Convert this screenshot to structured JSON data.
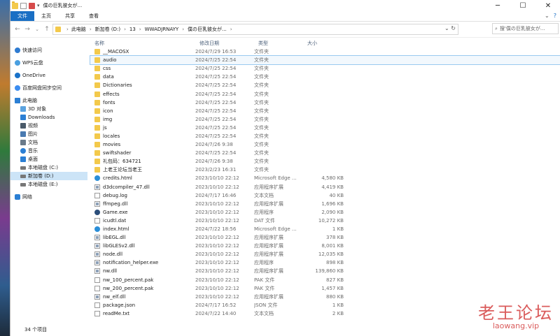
{
  "window": {
    "title": "僕の巨乳彼女が...",
    "controls": {
      "minimize": "─",
      "maximize": "☐",
      "close": "✕"
    }
  },
  "ribbon": {
    "tabs": [
      "文件",
      "主页",
      "共享",
      "查看"
    ],
    "active_tab": "文件"
  },
  "address": {
    "crumbs": [
      "此电脑",
      "新加卷 (D:)",
      "13",
      "WWADJRNAYY",
      "僕の巨乳彼女が..."
    ],
    "search_placeholder": "搜'僕の巨乳彼女が..."
  },
  "nav": {
    "items": [
      {
        "label": "快速访问",
        "icon": "star-icon",
        "color": "#2e7bd1",
        "indent": 1
      },
      {
        "label": "WPS云盘",
        "icon": "cloud-icon",
        "color": "#4a9fe0",
        "indent": 1
      },
      {
        "label": "OneDrive",
        "icon": "cloud-icon",
        "color": "#1a72c9",
        "indent": 1
      },
      {
        "label": "百度网盘同步空间",
        "icon": "cloud-icon",
        "color": "#3b8df0",
        "indent": 1
      },
      {
        "label": "此电脑",
        "icon": "computer-icon",
        "color": "#2b7fd4",
        "indent": 1
      },
      {
        "label": "3D 对象",
        "icon": "cube-icon",
        "color": "#5ba3e0",
        "indent": 2
      },
      {
        "label": "Downloads",
        "icon": "download-icon",
        "color": "#2b7fd4",
        "indent": 2
      },
      {
        "label": "视频",
        "icon": "video-icon",
        "color": "#4a5a6a",
        "indent": 2
      },
      {
        "label": "图片",
        "icon": "picture-icon",
        "color": "#4a7ab0",
        "indent": 2
      },
      {
        "label": "文档",
        "icon": "document-icon",
        "color": "#6a7a8a",
        "indent": 2
      },
      {
        "label": "音乐",
        "icon": "music-icon",
        "color": "#2b7fd4",
        "indent": 2
      },
      {
        "label": "桌面",
        "icon": "desktop-icon",
        "color": "#2b7fd4",
        "indent": 2
      },
      {
        "label": "本地磁盘 (C:)",
        "icon": "drive-icon",
        "color": "#777777",
        "indent": 2
      },
      {
        "label": "新加卷 (D:)",
        "icon": "drive-icon",
        "color": "#777777",
        "indent": 2,
        "selected": true
      },
      {
        "label": "本地磁盘 (E:)",
        "icon": "drive-icon",
        "color": "#777777",
        "indent": 2
      },
      {
        "label": "网络",
        "icon": "network-icon",
        "color": "#2b7fd4",
        "indent": 1
      }
    ]
  },
  "list": {
    "headers": {
      "name": "名称",
      "date": "修改日期",
      "type": "类型",
      "size": "大小"
    },
    "rows": [
      {
        "name": "__MACOSX",
        "date": "2024/7/29 16:53",
        "type": "文件夹",
        "size": "",
        "kind": "folder"
      },
      {
        "name": "audio",
        "date": "2024/7/25 22:54",
        "type": "文件夹",
        "size": "",
        "kind": "folder",
        "highlight": true
      },
      {
        "name": "css",
        "date": "2024/7/25 22:54",
        "type": "文件夹",
        "size": "",
        "kind": "folder"
      },
      {
        "name": "data",
        "date": "2024/7/25 22:54",
        "type": "文件夹",
        "size": "",
        "kind": "folder"
      },
      {
        "name": "Dictionaries",
        "date": "2024/7/25 22:54",
        "type": "文件夹",
        "size": "",
        "kind": "folder"
      },
      {
        "name": "effects",
        "date": "2024/7/25 22:54",
        "type": "文件夹",
        "size": "",
        "kind": "folder"
      },
      {
        "name": "fonts",
        "date": "2024/7/25 22:54",
        "type": "文件夹",
        "size": "",
        "kind": "folder"
      },
      {
        "name": "icon",
        "date": "2024/7/25 22:54",
        "type": "文件夹",
        "size": "",
        "kind": "folder"
      },
      {
        "name": "img",
        "date": "2024/7/25 22:54",
        "type": "文件夹",
        "size": "",
        "kind": "folder"
      },
      {
        "name": "js",
        "date": "2024/7/25 22:54",
        "type": "文件夹",
        "size": "",
        "kind": "folder"
      },
      {
        "name": "locales",
        "date": "2024/7/25 22:54",
        "type": "文件夹",
        "size": "",
        "kind": "folder"
      },
      {
        "name": "movies",
        "date": "2024/7/26 9:38",
        "type": "文件夹",
        "size": "",
        "kind": "folder"
      },
      {
        "name": "swiftshader",
        "date": "2024/7/25 22:54",
        "type": "文件夹",
        "size": "",
        "kind": "folder"
      },
      {
        "name": "礼包码：634721",
        "date": "2024/7/26 9:38",
        "type": "文件夹",
        "size": "",
        "kind": "folder"
      },
      {
        "name": "上老王论坛当老王",
        "date": "2023/2/23 16:31",
        "type": "文件夹",
        "size": "",
        "kind": "folder"
      },
      {
        "name": "credits.html",
        "date": "2023/10/10 22:12",
        "type": "Microsoft Edge ...",
        "size": "4,580 KB",
        "kind": "edge"
      },
      {
        "name": "d3dcompiler_47.dll",
        "date": "2023/10/10 22:12",
        "type": "应用程序扩展",
        "size": "4,419 KB",
        "kind": "dll"
      },
      {
        "name": "debug.log",
        "date": "2024/7/17 16:46",
        "type": "文本文档",
        "size": "40 KB",
        "kind": "file"
      },
      {
        "name": "ffmpeg.dll",
        "date": "2023/10/10 22:12",
        "type": "应用程序扩展",
        "size": "1,696 KB",
        "kind": "dll"
      },
      {
        "name": "Game.exe",
        "date": "2023/10/10 22:12",
        "type": "应用程序",
        "size": "2,090 KB",
        "kind": "exe"
      },
      {
        "name": "icudtl.dat",
        "date": "2023/10/10 22:12",
        "type": "DAT 文件",
        "size": "10,272 KB",
        "kind": "file"
      },
      {
        "name": "index.html",
        "date": "2024/7/22 18:56",
        "type": "Microsoft Edge ...",
        "size": "1 KB",
        "kind": "edge"
      },
      {
        "name": "libEGL.dll",
        "date": "2023/10/10 22:12",
        "type": "应用程序扩展",
        "size": "378 KB",
        "kind": "dll"
      },
      {
        "name": "libGLESv2.dll",
        "date": "2023/10/10 22:12",
        "type": "应用程序扩展",
        "size": "8,001 KB",
        "kind": "dll"
      },
      {
        "name": "node.dll",
        "date": "2023/10/10 22:12",
        "type": "应用程序扩展",
        "size": "12,035 KB",
        "kind": "dll"
      },
      {
        "name": "notification_helper.exe",
        "date": "2023/10/10 22:12",
        "type": "应用程序",
        "size": "898 KB",
        "kind": "dll"
      },
      {
        "name": "nw.dll",
        "date": "2023/10/10 22:12",
        "type": "应用程序扩展",
        "size": "139,860 KB",
        "kind": "dll"
      },
      {
        "name": "nw_100_percent.pak",
        "date": "2023/10/10 22:12",
        "type": "PAK 文件",
        "size": "827 KB",
        "kind": "file"
      },
      {
        "name": "nw_200_percent.pak",
        "date": "2023/10/10 22:12",
        "type": "PAK 文件",
        "size": "1,457 KB",
        "kind": "file"
      },
      {
        "name": "nw_elf.dll",
        "date": "2023/10/10 22:12",
        "type": "应用程序扩展",
        "size": "880 KB",
        "kind": "dll"
      },
      {
        "name": "package.json",
        "date": "2024/7/17 16:52",
        "type": "JSON 文件",
        "size": "1 KB",
        "kind": "file"
      },
      {
        "name": "readMe.txt",
        "date": "2024/7/22 14:40",
        "type": "文本文档",
        "size": "2 KB",
        "kind": "file"
      }
    ]
  },
  "status": {
    "count": "34 个项目"
  },
  "watermark": {
    "top": "老王论坛",
    "bottom": "laowang.vip"
  }
}
